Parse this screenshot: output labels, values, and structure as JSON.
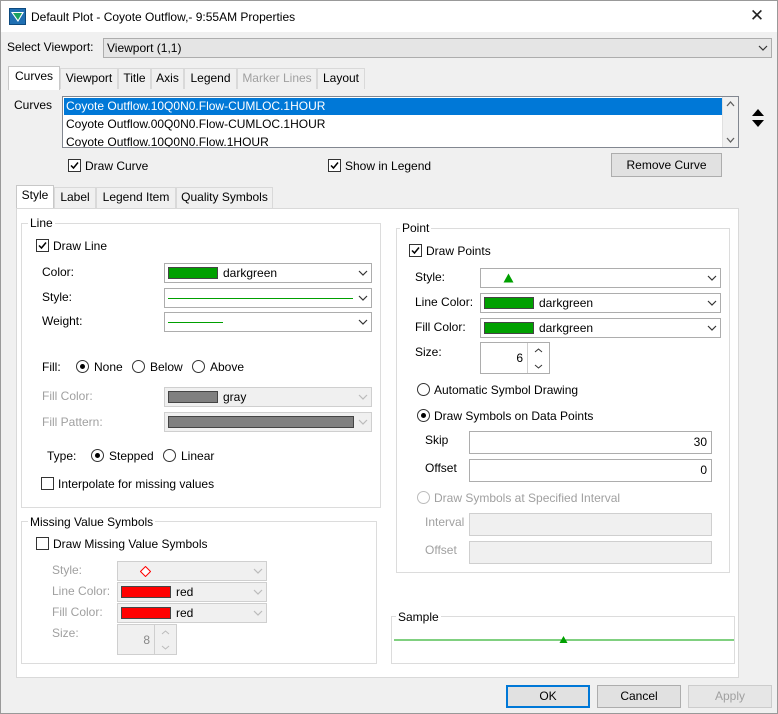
{
  "window": {
    "title": "Default Plot - Coyote Outflow,- 9:55AM Properties",
    "close_glyph": "✕"
  },
  "viewport": {
    "label": "Select Viewport:",
    "value": "Viewport (1,1)"
  },
  "main_tabs": [
    {
      "label": "Curves",
      "state": "selected"
    },
    {
      "label": "Viewport",
      "state": "normal"
    },
    {
      "label": "Title",
      "state": "normal"
    },
    {
      "label": "Axis",
      "state": "normal"
    },
    {
      "label": "Legend",
      "state": "normal"
    },
    {
      "label": "Marker Lines",
      "state": "disabled"
    },
    {
      "label": "Layout",
      "state": "normal"
    }
  ],
  "curves": {
    "label": "Curves",
    "items": [
      "Coyote Outflow.10Q0N0.Flow-CUMLOC.1HOUR",
      "Coyote Outflow.00Q0N0.Flow-CUMLOC.1HOUR",
      "Coyote Outflow.10Q0N0.Flow.1HOUR"
    ],
    "selected_index": 0,
    "draw_curve": {
      "label": "Draw Curve",
      "checked": true
    },
    "show_in_legend": {
      "label": "Show in Legend",
      "checked": true
    },
    "remove_button": "Remove Curve"
  },
  "sub_tabs": [
    {
      "label": "Style",
      "state": "selected"
    },
    {
      "label": "Label",
      "state": "normal"
    },
    {
      "label": "Legend Item",
      "state": "normal"
    },
    {
      "label": "Quality Symbols",
      "state": "normal"
    }
  ],
  "line": {
    "group_title": "Line",
    "draw_line": {
      "label": "Draw Line",
      "checked": true
    },
    "color_label": "Color:",
    "color": {
      "name": "darkgreen",
      "hex": "#00a000"
    },
    "style_label": "Style:",
    "weight_label": "Weight:",
    "fill_label": "Fill:",
    "fill_options": [
      "None",
      "Below",
      "Above"
    ],
    "fill_selected": "None",
    "fill_color_label": "Fill Color:",
    "fill_color": {
      "name": "gray",
      "hex": "#808080"
    },
    "fill_pattern_label": "Fill Pattern:",
    "type_label": "Type:",
    "type_options": [
      "Stepped",
      "Linear"
    ],
    "type_selected": "Stepped",
    "interpolate": {
      "label": "Interpolate for missing values",
      "checked": false
    }
  },
  "missing": {
    "group_title": "Missing Value Symbols",
    "draw": {
      "label": "Draw Missing Value Symbols",
      "checked": false
    },
    "style_label": "Style:",
    "line_color_label": "Line Color:",
    "line_color": {
      "name": "red",
      "hex": "#ff0000"
    },
    "fill_color_label": "Fill Color:",
    "fill_color": {
      "name": "red",
      "hex": "#ff0000"
    },
    "size_label": "Size:",
    "size": "8"
  },
  "point": {
    "group_title": "Point",
    "draw_points": {
      "label": "Draw Points",
      "checked": true
    },
    "style_label": "Style:",
    "line_color_label": "Line Color:",
    "line_color": {
      "name": "darkgreen",
      "hex": "#00a000"
    },
    "fill_color_label": "Fill Color:",
    "fill_color": {
      "name": "darkgreen",
      "hex": "#00a000"
    },
    "size_label": "Size:",
    "size": "6",
    "auto_symbol": "Automatic Symbol Drawing",
    "on_data_points": "Draw Symbols on Data Points",
    "symbol_mode": "on_data_points",
    "skip_label": "Skip",
    "skip": "30",
    "offset_label": "Offset",
    "offset": "0",
    "at_interval": "Draw Symbols at Specified Interval",
    "interval_label": "Interval",
    "interval_offset_label": "Offset"
  },
  "sample": {
    "title": "Sample"
  },
  "buttons": {
    "ok": "OK",
    "cancel": "Cancel",
    "apply": "Apply"
  }
}
